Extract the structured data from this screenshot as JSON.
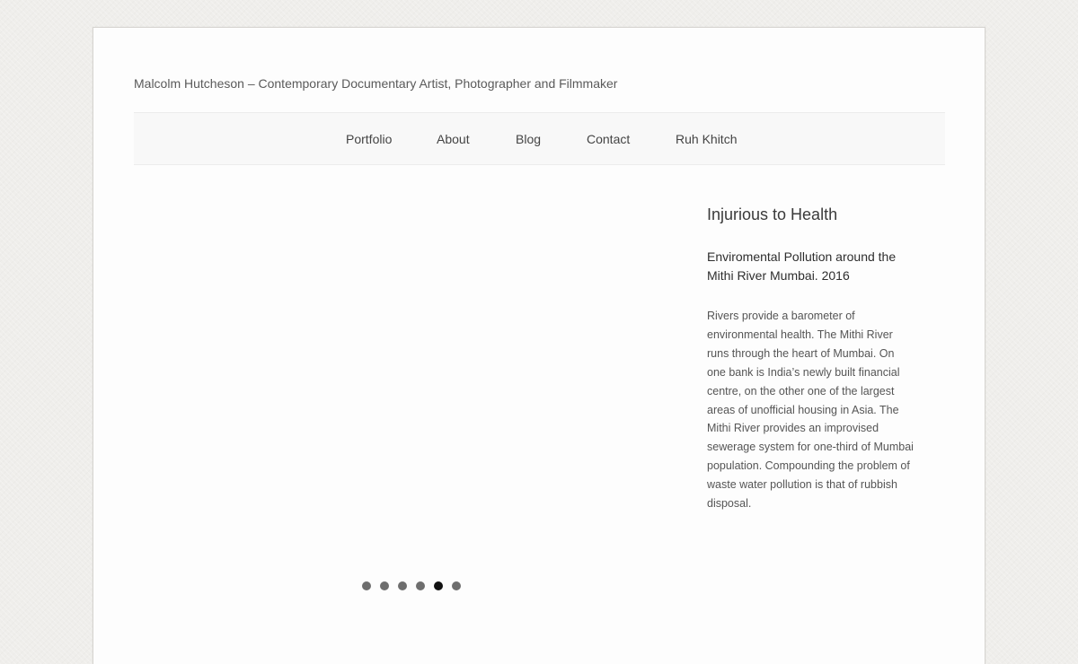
{
  "header": {
    "site_title": "Malcolm Hutcheson – Contemporary Documentary Artist, Photographer and Filmmaker"
  },
  "nav": {
    "items": [
      {
        "label": "Portfolio"
      },
      {
        "label": "About"
      },
      {
        "label": "Blog"
      },
      {
        "label": "Contact"
      },
      {
        "label": "Ruh Khitch"
      }
    ]
  },
  "slider": {
    "dot_count": 6,
    "active_index": 4
  },
  "caption": {
    "title": "Injurious to Health",
    "subtitle": "Enviromental Pollution around the Mithi River Mumbai. 2016",
    "body": "Rivers provide a barometer of environmental health. The Mithi River runs through the heart of Mumbai. On one bank is India’s newly built financial centre, on the other one of the largest areas of unofficial housing in Asia. The Mithi River provides an improvised sewerage system for one-third of Mumbai population. Compounding the problem of waste water pollution is that of rubbish disposal."
  },
  "colors": {
    "background": "#efeeeb",
    "page": "#fdfdfd",
    "nav_bar": "#f8f8f8",
    "dot": "#6e6e6e",
    "dot_active": "#111111"
  }
}
